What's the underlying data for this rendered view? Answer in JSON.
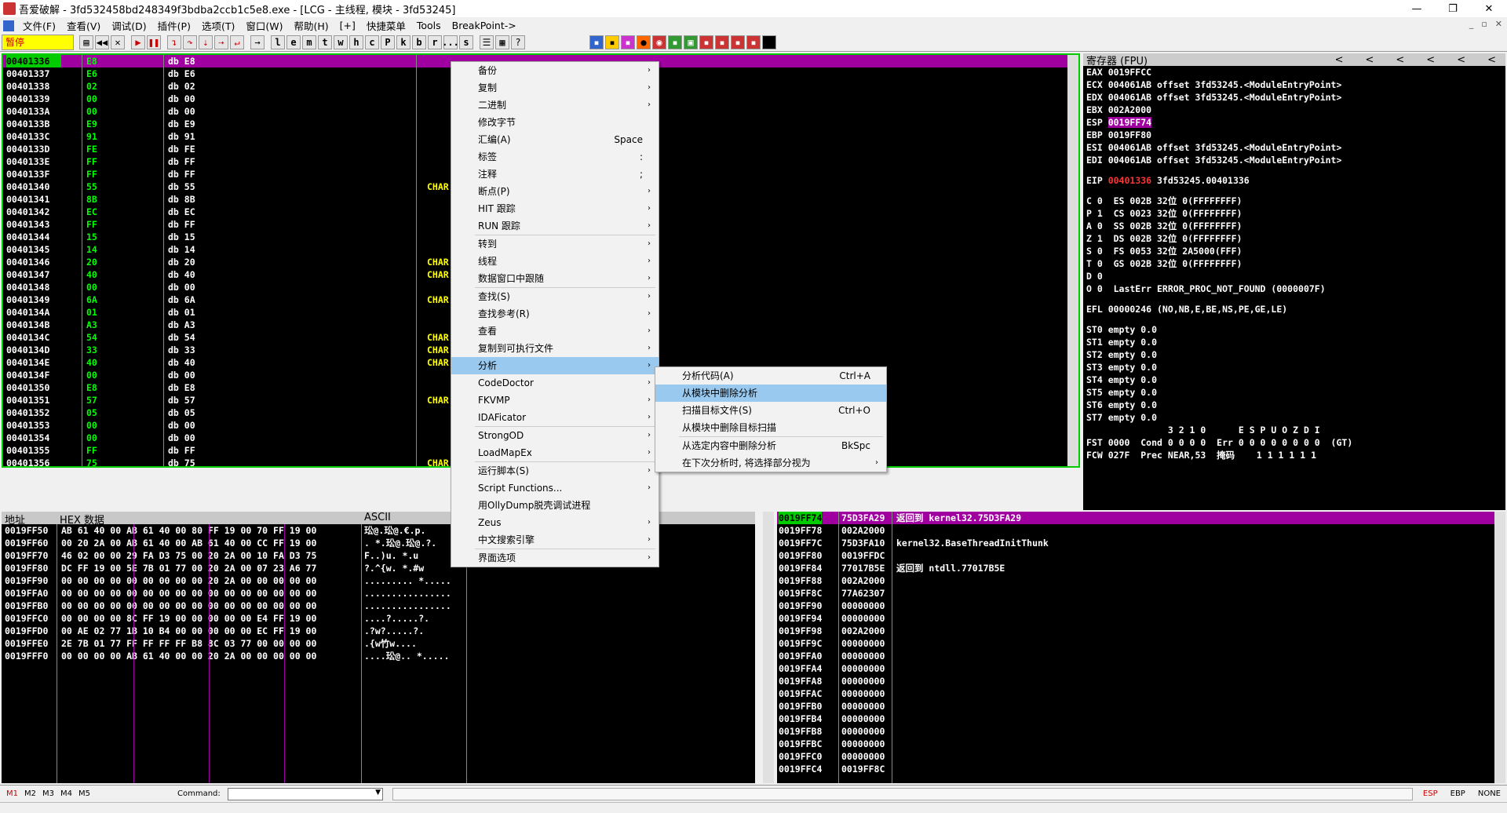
{
  "titlebar": {
    "title": "吾爱破解 - 3fd532458bd248349f3bdba2ccb1c5e8.exe - [LCG - 主线程, 模块 - 3fd53245]",
    "min": "—",
    "max": "❐",
    "close": "✕"
  },
  "menubar": {
    "items": [
      "文件(F)",
      "查看(V)",
      "调试(D)",
      "插件(P)",
      "选项(T)",
      "窗口(W)",
      "帮助(H)",
      "[+]",
      "快捷菜单",
      "Tools",
      "BreakPoint->"
    ],
    "mdi": [
      "_",
      "▫",
      "✕"
    ]
  },
  "toolbar": {
    "status": "暂停",
    "letters": [
      "l",
      "e",
      "m",
      "t",
      "w",
      "h",
      "c",
      "P",
      "k",
      "b",
      "r",
      "...",
      "s"
    ]
  },
  "cpu": {
    "rows": [
      {
        "addr": "00401336",
        "hex": "E8",
        "dis": "db E8",
        "cmt": ""
      },
      {
        "addr": "00401337",
        "hex": "E6",
        "dis": "db E6",
        "cmt": ""
      },
      {
        "addr": "00401338",
        "hex": "02",
        "dis": "db 02",
        "cmt": ""
      },
      {
        "addr": "00401339",
        "hex": "00",
        "dis": "db 00",
        "cmt": ""
      },
      {
        "addr": "0040133A",
        "hex": "00",
        "dis": "db 00",
        "cmt": ""
      },
      {
        "addr": "0040133B",
        "hex": "E9",
        "dis": "db E9",
        "cmt": ""
      },
      {
        "addr": "0040133C",
        "hex": "91",
        "dis": "db 91",
        "cmt": ""
      },
      {
        "addr": "0040133D",
        "hex": "FE",
        "dis": "db FE",
        "cmt": ""
      },
      {
        "addr": "0040133E",
        "hex": "FF",
        "dis": "db FF",
        "cmt": ""
      },
      {
        "addr": "0040133F",
        "hex": "FF",
        "dis": "db FF",
        "cmt": ""
      },
      {
        "addr": "00401340",
        "hex": "55",
        "dis": "db 55",
        "cmt": "CHAR"
      },
      {
        "addr": "00401341",
        "hex": "8B",
        "dis": "db 8B",
        "cmt": ""
      },
      {
        "addr": "00401342",
        "hex": "EC",
        "dis": "db EC",
        "cmt": ""
      },
      {
        "addr": "00401343",
        "hex": "FF",
        "dis": "db FF",
        "cmt": ""
      },
      {
        "addr": "00401344",
        "hex": "15",
        "dis": "db 15",
        "cmt": ""
      },
      {
        "addr": "00401345",
        "hex": "14",
        "dis": "db 14",
        "cmt": ""
      },
      {
        "addr": "00401346",
        "hex": "20",
        "dis": "db 20",
        "cmt": "CHAR"
      },
      {
        "addr": "00401347",
        "hex": "40",
        "dis": "db 40",
        "cmt": "CHAR"
      },
      {
        "addr": "00401348",
        "hex": "00",
        "dis": "db 00",
        "cmt": ""
      },
      {
        "addr": "00401349",
        "hex": "6A",
        "dis": "db 6A",
        "cmt": "CHAR"
      },
      {
        "addr": "0040134A",
        "hex": "01",
        "dis": "db 01",
        "cmt": ""
      },
      {
        "addr": "0040134B",
        "hex": "A3",
        "dis": "db A3",
        "cmt": ""
      },
      {
        "addr": "0040134C",
        "hex": "54",
        "dis": "db 54",
        "cmt": "CHAR"
      },
      {
        "addr": "0040134D",
        "hex": "33",
        "dis": "db 33",
        "cmt": "CHAR"
      },
      {
        "addr": "0040134E",
        "hex": "40",
        "dis": "db 40",
        "cmt": "CHAR"
      },
      {
        "addr": "0040134F",
        "hex": "00",
        "dis": "db 00",
        "cmt": ""
      },
      {
        "addr": "00401350",
        "hex": "E8",
        "dis": "db E8",
        "cmt": ""
      },
      {
        "addr": "00401351",
        "hex": "57",
        "dis": "db 57",
        "cmt": "CHAR"
      },
      {
        "addr": "00401352",
        "hex": "05",
        "dis": "db 05",
        "cmt": ""
      },
      {
        "addr": "00401353",
        "hex": "00",
        "dis": "db 00",
        "cmt": ""
      },
      {
        "addr": "00401354",
        "hex": "00",
        "dis": "db 00",
        "cmt": ""
      },
      {
        "addr": "00401355",
        "hex": "FF",
        "dis": "db FF",
        "cmt": ""
      },
      {
        "addr": "00401356",
        "hex": "75",
        "dis": "db 75",
        "cmt": "CHAR"
      }
    ]
  },
  "registers": {
    "title": "寄存器 (FPU)",
    "arrows": [
      "<",
      "<",
      "<",
      "<",
      "<",
      "<"
    ],
    "lines": [
      "EAX 0019FFCC",
      "ECX 004061AB offset 3fd53245.<ModuleEntryPoint>",
      "EDX 004061AB offset 3fd53245.<ModuleEntryPoint>",
      "EBX 002A2000",
      "ESP|0019FF74",
      "EBP 0019FF80",
      "ESI 004061AB offset 3fd53245.<ModuleEntryPoint>",
      "EDI 004061AB offset 3fd53245.<ModuleEntryPoint>",
      "",
      "EIP|00401336|3fd53245.00401336",
      "",
      "C 0  ES 002B 32位 0(FFFFFFFF)",
      "P 1  CS 0023 32位 0(FFFFFFFF)",
      "A 0  SS 002B 32位 0(FFFFFFFF)",
      "Z 1  DS 002B 32位 0(FFFFFFFF)",
      "S 0  FS 0053 32位 2A5000(FFF)",
      "T 0  GS 002B 32位 0(FFFFFFFF)",
      "D 0",
      "O 0  LastErr ERROR_PROC_NOT_FOUND (0000007F)",
      "",
      "EFL 00000246 (NO,NB,E,BE,NS,PE,GE,LE)",
      "",
      "ST0 empty 0.0",
      "ST1 empty 0.0",
      "ST2 empty 0.0",
      "ST3 empty 0.0",
      "ST4 empty 0.0",
      "ST5 empty 0.0",
      "ST6 empty 0.0",
      "ST7 empty 0.0",
      "               3 2 1 0      E S P U O Z D I",
      "FST 0000  Cond 0 0 0 0  Err 0 0 0 0 0 0 0 0  (GT)",
      "FCW 027F  Prec NEAR,53  掩码    1 1 1 1 1 1"
    ]
  },
  "dump": {
    "headers": [
      "地址",
      "HEX 数据",
      "ASCII"
    ],
    "rows": [
      {
        "addr": "0019FF50",
        "hex": "AB 61 40 00 AB 61 40 00 80 FF 19 00 70 FF 19 00",
        "ascii": "玜@.玜@.€\u0019.p\u0019."
      },
      {
        "addr": "0019FF60",
        "hex": "00 20 2A 00 AB 61 40 00 AB 61 40 00 CC FF 19 00",
        "ascii": ". *.玜@.玜@.?\u0019."
      },
      {
        "addr": "0019FF70",
        "hex": "46 02 00 00 29 FA D3 75 00 20 2A 00 10 FA D3 75",
        "ascii": "F\u0002..)u. *.\u0010u"
      },
      {
        "addr": "0019FF80",
        "hex": "DC FF 19 00 5E 7B 01 77 00 20 2A 00 07 23 A6 77",
        "ascii": "?\u0019.^{\u0001w. *.\u0007#w"
      },
      {
        "addr": "0019FF90",
        "hex": "00 00 00 00 00 00 00 00 00 20 2A 00 00 00 00 00",
        "ascii": "......... *....."
      },
      {
        "addr": "0019FFA0",
        "hex": "00 00 00 00 00 00 00 00 00 00 00 00 00 00 00 00",
        "ascii": "................"
      },
      {
        "addr": "0019FFB0",
        "hex": "00 00 00 00 00 00 00 00 00 00 00 00 00 00 00 00",
        "ascii": "................"
      },
      {
        "addr": "0019FFC0",
        "hex": "00 00 00 00 8C FF 19 00 00 00 00 00 E4 FF 19 00",
        "ascii": "....?\u0019.....?."
      },
      {
        "addr": "0019FFD0",
        "hex": "00 AE 02 77 1B 10 B4 00 00 00 00 00 EC FF 19 00",
        "ascii": ".?w\u001b\u0010?.....?."
      },
      {
        "addr": "0019FFE0",
        "hex": "2E 7B 01 77 FF FF FF FF B8 8C 03 77 00 00 00 00",
        "ascii": ".{\u0001w竹\u0003w...."
      },
      {
        "addr": "0019FFF0",
        "hex": "00 00 00 00 AB 61 40 00 00 20 2A 00 00 00 00 00",
        "ascii": "....玜@.. *....."
      }
    ]
  },
  "stack": {
    "rows": [
      {
        "a": "0019FF74",
        "v": "75D3FA29",
        "c": "返回到 kernel32.75D3FA29"
      },
      {
        "a": "0019FF78",
        "v": "002A2000",
        "c": ""
      },
      {
        "a": "0019FF7C",
        "v": "75D3FA10",
        "c": "kernel32.BaseThreadInitThunk"
      },
      {
        "a": "0019FF80",
        "v": "0019FFDC",
        "c": ""
      },
      {
        "a": "0019FF84",
        "v": "77017B5E",
        "c": "返回到 ntdll.77017B5E"
      },
      {
        "a": "0019FF88",
        "v": "002A2000",
        "c": ""
      },
      {
        "a": "0019FF8C",
        "v": "77A62307",
        "c": ""
      },
      {
        "a": "0019FF90",
        "v": "00000000",
        "c": ""
      },
      {
        "a": "0019FF94",
        "v": "00000000",
        "c": ""
      },
      {
        "a": "0019FF98",
        "v": "002A2000",
        "c": ""
      },
      {
        "a": "0019FF9C",
        "v": "00000000",
        "c": ""
      },
      {
        "a": "0019FFA0",
        "v": "00000000",
        "c": ""
      },
      {
        "a": "0019FFA4",
        "v": "00000000",
        "c": ""
      },
      {
        "a": "0019FFA8",
        "v": "00000000",
        "c": ""
      },
      {
        "a": "0019FFAC",
        "v": "00000000",
        "c": ""
      },
      {
        "a": "0019FFB0",
        "v": "00000000",
        "c": ""
      },
      {
        "a": "0019FFB4",
        "v": "00000000",
        "c": ""
      },
      {
        "a": "0019FFB8",
        "v": "00000000",
        "c": ""
      },
      {
        "a": "0019FFBC",
        "v": "00000000",
        "c": ""
      },
      {
        "a": "0019FFC0",
        "v": "00000000",
        "c": ""
      },
      {
        "a": "0019FFC4",
        "v": "0019FF8C",
        "c": ""
      }
    ]
  },
  "bottom": {
    "marks": [
      "M1",
      "M2",
      "M3",
      "M4",
      "M5"
    ],
    "command_label": "Command:",
    "right": [
      "ESP",
      "EBP",
      "NONE"
    ]
  },
  "context_menu": {
    "items": [
      {
        "label": "备份",
        "arrow": "›"
      },
      {
        "label": "复制",
        "arrow": "›"
      },
      {
        "label": "二进制",
        "arrow": "›"
      },
      {
        "label": "修改字节",
        "arrow": ""
      },
      {
        "label": "汇编(A)",
        "sc": "Space"
      },
      {
        "label": "标签",
        "sc": ":"
      },
      {
        "label": "注释",
        "sc": ";"
      },
      {
        "label": "断点(P)",
        "arrow": "›"
      },
      {
        "label": "HIT 跟踪",
        "arrow": "›"
      },
      {
        "label": "RUN 跟踪",
        "arrow": "›"
      },
      {
        "sep": true
      },
      {
        "label": "转到",
        "arrow": "›"
      },
      {
        "label": "线程",
        "arrow": "›"
      },
      {
        "label": "数据窗口中跟随",
        "arrow": "›"
      },
      {
        "sep": true
      },
      {
        "label": "查找(S)",
        "arrow": "›"
      },
      {
        "label": "查找参考(R)",
        "arrow": "›"
      },
      {
        "label": "查看",
        "arrow": "›"
      },
      {
        "label": "复制到可执行文件",
        "arrow": "›"
      },
      {
        "label": "分析",
        "arrow": "›",
        "hl": true
      },
      {
        "label": "CodeDoctor",
        "arrow": "›"
      },
      {
        "label": "FKVMP",
        "arrow": "›"
      },
      {
        "label": "IDAFicator",
        "arrow": "›"
      },
      {
        "sep": true
      },
      {
        "label": "StrongOD",
        "arrow": "›"
      },
      {
        "label": "LoadMapEx",
        "arrow": "›"
      },
      {
        "sep": true
      },
      {
        "label": "运行脚本(S)",
        "arrow": "›"
      },
      {
        "label": "Script Functions...",
        "arrow": "›"
      },
      {
        "label": "用OllyDump脱壳调试进程",
        "arrow": ""
      },
      {
        "label": "Zeus",
        "arrow": "›"
      },
      {
        "label": "中文搜索引擎",
        "arrow": "›"
      },
      {
        "sep": true
      },
      {
        "label": "界面选项",
        "arrow": "›"
      }
    ]
  },
  "submenu": {
    "items": [
      {
        "label": "分析代码(A)",
        "sc": "Ctrl+A"
      },
      {
        "label": "从模块中删除分析",
        "sc": "",
        "hl": true
      },
      {
        "label": "扫描目标文件(S)",
        "sc": "Ctrl+O"
      },
      {
        "label": "从模块中删除目标扫描",
        "sc": ""
      },
      {
        "sep": true
      },
      {
        "label": "从选定内容中删除分析",
        "sc": "BkSpc"
      },
      {
        "label": "在下次分析时, 将选择部分视为",
        "arrow": "›"
      }
    ]
  }
}
